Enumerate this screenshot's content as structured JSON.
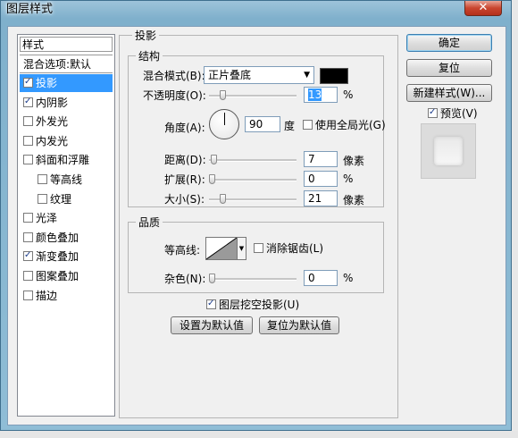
{
  "window": {
    "title": "图层样式",
    "close_glyph": "✕"
  },
  "styles_list": {
    "header": "样式",
    "blend_options": "混合选项:默认",
    "items": [
      {
        "label": "投影",
        "checked": true,
        "selected": true
      },
      {
        "label": "内阴影",
        "checked": true
      },
      {
        "label": "外发光",
        "checked": false
      },
      {
        "label": "内发光",
        "checked": false
      },
      {
        "label": "斜面和浮雕",
        "checked": false
      },
      {
        "label": "等高线",
        "checked": false,
        "sub": true
      },
      {
        "label": "纹理",
        "checked": false,
        "sub": true
      },
      {
        "label": "光泽",
        "checked": false
      },
      {
        "label": "颜色叠加",
        "checked": false
      },
      {
        "label": "渐变叠加",
        "checked": true
      },
      {
        "label": "图案叠加",
        "checked": false
      },
      {
        "label": "描边",
        "checked": false
      }
    ]
  },
  "drop_shadow": {
    "group_title": "投影",
    "structure": {
      "title": "结构",
      "blend_mode_label": "混合模式(B):",
      "blend_mode_value": "正片叠底",
      "color": "#000000",
      "opacity_label": "不透明度(O):",
      "opacity_value": "13",
      "opacity_unit": "%",
      "opacity_fraction": 0.13,
      "angle_label": "角度(A):",
      "angle_value": "90",
      "angle_unit": "度",
      "global_light_label": "使用全局光(G)",
      "global_light_checked": false,
      "distance_label": "距离(D):",
      "distance_value": "7",
      "distance_unit": "像素",
      "spread_label": "扩展(R):",
      "spread_value": "0",
      "spread_unit": "%",
      "size_label": "大小(S):",
      "size_value": "21",
      "size_unit": "像素"
    },
    "quality": {
      "title": "品质",
      "contour_label": "等高线:",
      "anti_alias_label": "消除锯齿(L)",
      "anti_alias_checked": false,
      "noise_label": "杂色(N):",
      "noise_value": "0",
      "noise_unit": "%"
    },
    "knockout_label": "图层挖空投影(U)",
    "knockout_checked": true,
    "set_default": "设置为默认值",
    "reset_default": "复位为默认值"
  },
  "buttons": {
    "ok": "确定",
    "reset": "复位",
    "new_style": "新建样式(W)...",
    "preview_label": "预览(V)",
    "preview_checked": true
  }
}
